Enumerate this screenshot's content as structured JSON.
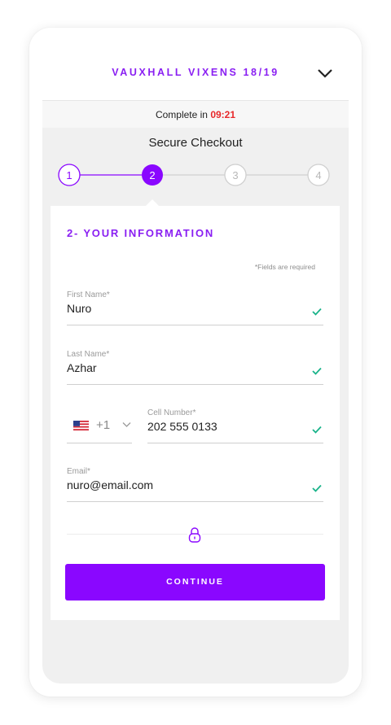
{
  "header": {
    "event_title": "VAUXHALL VIXENS 18/19",
    "chevron_icon": "chevron-down-icon"
  },
  "timer": {
    "label": "Complete in",
    "time": "09:21",
    "time_color": "#e8282a"
  },
  "checkout": {
    "title": "Secure Checkout",
    "steps": [
      {
        "label": "1",
        "state": "completed"
      },
      {
        "label": "2",
        "state": "active"
      },
      {
        "label": "3",
        "state": "upcoming"
      },
      {
        "label": "4",
        "state": "upcoming"
      }
    ]
  },
  "form": {
    "section_title": "2- YOUR INFORMATION",
    "required_note": "*Fields are required",
    "first_name": {
      "label": "First Name*",
      "value": "Nuro"
    },
    "last_name": {
      "label": "Last Name*",
      "value": "Azhar"
    },
    "country_code": {
      "value": "+1",
      "flag_icon": "us-flag-icon"
    },
    "cell_number": {
      "label": "Cell Number*",
      "value": "202 555 0133"
    },
    "email": {
      "label": "Email*",
      "value": "nuro@email.com"
    },
    "continue_label": "CONTINUE"
  },
  "colors": {
    "accent": "#8a07ff",
    "valid_check": "#19b38a",
    "page_bg": "#f0f0f0"
  }
}
